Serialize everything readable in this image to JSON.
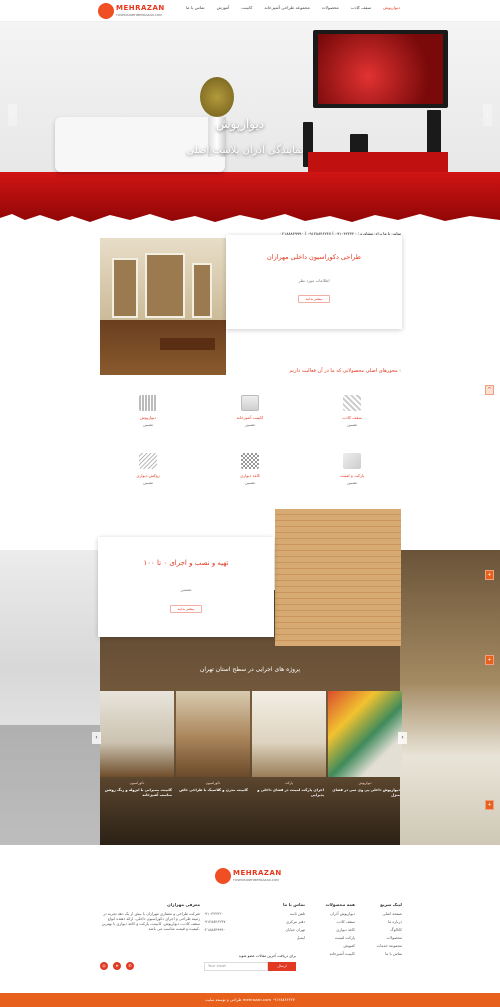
{
  "header": {
    "logo_text": "MEHRAZAN",
    "logo_sub": "TOSEKHANEHMEHRAZAN.COM",
    "nav": [
      "دیوارپوش",
      "سقف کاذب",
      "محصولات",
      "مجموعه طراحی آشپزخانه",
      "کابینت",
      "آموزش",
      "تماس با ما"
    ]
  },
  "hero": {
    "title": "دیوارپوش",
    "subtitle": "نمایندگی آذران پلاست اصلی",
    "prev": "‹",
    "next": "›"
  },
  "contact_line": "تماس با ما برای مشاوره : ۰۹۱۰۴۲۲۴۲۰ | ۰۹۱۲۸۸۴۶۲۴۷ | ۰۲۱۸۸۸۴۹۹۹۰",
  "about": {
    "title": "طراحی دکوراسیون داخلی مهرازان",
    "subtitle": "اطلاعات مورد نظر",
    "button": "بیشتر بدانید"
  },
  "services_title": "محورهای اصلی محصولاتی که ما در آن فعالیت داریم :",
  "services": [
    {
      "name": "سقف کاذب",
      "desc": "تضمین"
    },
    {
      "name": "کابینت آشپزخانه",
      "desc": "تضمین"
    },
    {
      "name": "دیوارپوش",
      "desc": "تضمین"
    },
    {
      "name": "پارکت و لمینت",
      "desc": "تضمین"
    },
    {
      "name": "کاغذ دیواری",
      "desc": "تضمین"
    },
    {
      "name": "روکش دیواری",
      "desc": "تضمین"
    }
  ],
  "sauna": {
    "title": "تهیه و نصب و اجرای ۰ تا ۱۰۰",
    "subtitle": "تضمین",
    "button": "بیشتر بدانید"
  },
  "projects_title": "پروژه های اجرایی در سطح استان تهران",
  "projects": [
    {
      "tag": "دکوراسیون",
      "caption": "کابینت ممبرانی با ایزوله و رنگ روشن مناسب آشپزخانه"
    },
    {
      "tag": "دکوراسیون",
      "caption": "کابینت مدرن و کلاسیک با طراحی خاص"
    },
    {
      "tag": "پارکت",
      "caption": "اجرای پارکت لمینت در فضای داخلی و پذیرایی"
    },
    {
      "tag": "دیوارپوش",
      "caption": "دیوارپوش داخلی پی وی سی در فضای منزل"
    }
  ],
  "footer": {
    "about_head": "معرفی مهرازان",
    "about_text": "شرکت طراحی و معماری مهرازان با بیش از یک دهه تجربه در زمینه طراحی و اجرای دکوراسیون داخلی، ارائه دهنده انواع سقف کاذب، دیوارپوش، کابینت، پارکت و کاغذ دیواری با بهترین کیفیت و قیمت مناسب می باشد.",
    "col1_head": "لینک سریع",
    "col1": [
      "صفحه اصلی",
      "درباره ما",
      "کاتالوگ",
      "محصولات",
      "مجموعه خدمات",
      "تماس با ما"
    ],
    "col2_head": "همه محصولات",
    "col2": [
      "دیوارپوش آذران",
      "سقف کاذب",
      "کاغذ دیواری",
      "پارکت لمینت",
      "کفپوش",
      "کابینت آشپزخانه"
    ],
    "col3_head": "تماس با ما",
    "col3": [
      "تلفن ثابت",
      "دفتر مرکزی",
      "تهران خیابان",
      "ایمیل"
    ],
    "phones": [
      "۰۹۱۰۴۲۲۴۲۰",
      "۰۹۱۲۸۸۴۶۲۴۷",
      "۰۲۱۸۸۸۴۹۹۹۰"
    ],
    "newsletter_label": "برای دریافت آخرین مقالات عضو شوید",
    "email_placeholder": "Your email",
    "subscribe": "ارسال"
  },
  "bottom_bar": "طراحی و توسعه سایت mehrazan.com ۰۹۱۲۸۸۴۶۲۴۷",
  "colors": {
    "accent": "#e23a22",
    "bar": "#e8611c"
  }
}
